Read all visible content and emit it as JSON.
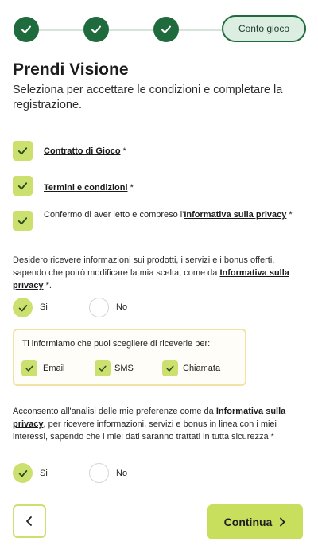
{
  "stepper": {
    "current_label": "Conto gioco"
  },
  "header": {
    "title": "Prendi Visione",
    "subtitle": "Seleziona per accettare le condizioni e completare la registrazione."
  },
  "consents": {
    "contract_link": "Contratto di Gioco",
    "contract_suffix": " *",
    "terms_link": "Termini e condizioni",
    "terms_suffix": " *",
    "privacy_prefix": "Confermo di aver letto e compreso l'",
    "privacy_link": "Informativa sulla privacy",
    "privacy_suffix": " *"
  },
  "marketing": {
    "text_prefix": "Desidero ricevere informazioni sui prodotti, i servizi e i bonus offerti, sapendo che potrò modificare la mia scelta, come da ",
    "text_link": "Informativa sulla privacy",
    "text_suffix": " *.",
    "yes_label": "Si",
    "no_label": "No",
    "selected": "Si"
  },
  "channels": {
    "title": "Ti informiamo che puoi scegliere di riceverle per:",
    "email_label": "Email",
    "sms_label": "SMS",
    "call_label": "Chiamata"
  },
  "profiling": {
    "text_prefix": "Acconsento all'analisi delle mie preferenze come da ",
    "text_link": "Informativa sulla privacy",
    "text_suffix": ", per ricevere informazioni, servizi e bonus in linea con i miei interessi, sapendo che i miei dati saranno trattati in tutta sicurezza *",
    "yes_label": "Si",
    "no_label": "No",
    "selected": "Si"
  },
  "footer": {
    "continue_label": "Continua"
  },
  "colors": {
    "primary_green": "#1f6b3e",
    "lime": "#cbe06f",
    "box_border": "#f2e2a5"
  },
  "icons": [
    "check-icon",
    "chevron-left-icon",
    "chevron-right-icon"
  ]
}
